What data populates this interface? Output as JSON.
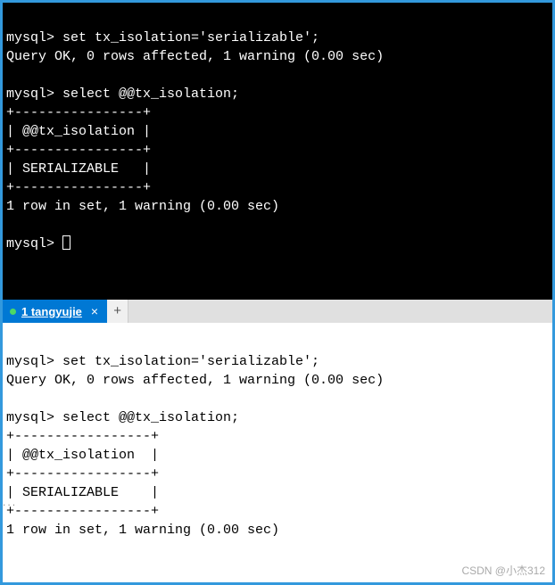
{
  "top_terminal": {
    "line1": "mysql> set tx_isolation='serializable';",
    "line2": "Query OK, 0 rows affected, 1 warning (0.00 sec)",
    "line3": "",
    "line4": "mysql> select @@tx_isolation;",
    "line5": "+----------------+",
    "line6": "| @@tx_isolation |",
    "line7": "+----------------+",
    "line8": "| SERIALIZABLE   |",
    "line9": "+----------------+",
    "line10": "1 row in set, 1 warning (0.00 sec)",
    "line11": "",
    "prompt": "mysql> "
  },
  "tab": {
    "title": "1 tangyujie",
    "close": "×",
    "add": "+"
  },
  "bottom_terminal": {
    "line1": "mysql> set tx_isolation='serializable';",
    "line2": "Query OK, 0 rows affected, 1 warning (0.00 sec)",
    "line3": "",
    "line4": "mysql> select @@tx_isolation;",
    "line5": "+-----------------+",
    "line6": "| @@tx_isolation  |",
    "line7": "+-----------------+",
    "line8": "| SERIALIZABLE    |",
    "line9": "+-----------------+",
    "line10": "1 row in set, 1 warning (0.00 sec)"
  },
  "watermark": "CSDN @小杰312",
  "margin_dots": "..."
}
